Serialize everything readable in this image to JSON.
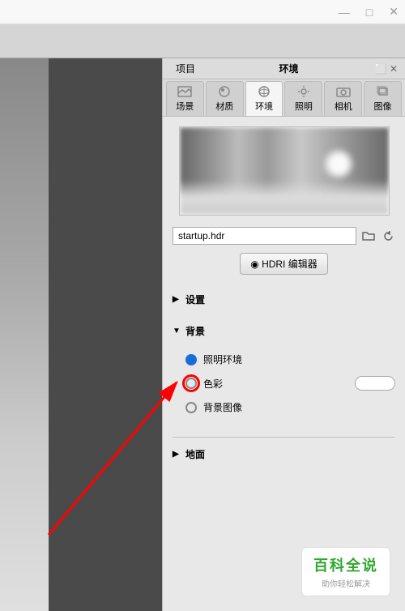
{
  "titlebar": {
    "minimize": "—",
    "maximize": "□",
    "close": "✕"
  },
  "panel": {
    "project_label": "项目",
    "env_title": "环境",
    "popout": "⬜",
    "close": "✕"
  },
  "tabs": [
    {
      "label": "场景",
      "icon": "scene"
    },
    {
      "label": "材质",
      "icon": "material"
    },
    {
      "label": "环境",
      "icon": "environment"
    },
    {
      "label": "照明",
      "icon": "lighting"
    },
    {
      "label": "相机",
      "icon": "camera"
    },
    {
      "label": "图像",
      "icon": "image"
    }
  ],
  "hdri": {
    "filename": "startup.hdr",
    "editor_button": "HDRI 编辑器"
  },
  "sections": {
    "settings": "设置",
    "background": "背景",
    "ground": "地面"
  },
  "background_options": {
    "lighting_env": "照明环境",
    "color": "色彩",
    "bg_image": "背景图像"
  },
  "watermark": {
    "title": "百科全说",
    "subtitle": "助你轻松解决"
  }
}
